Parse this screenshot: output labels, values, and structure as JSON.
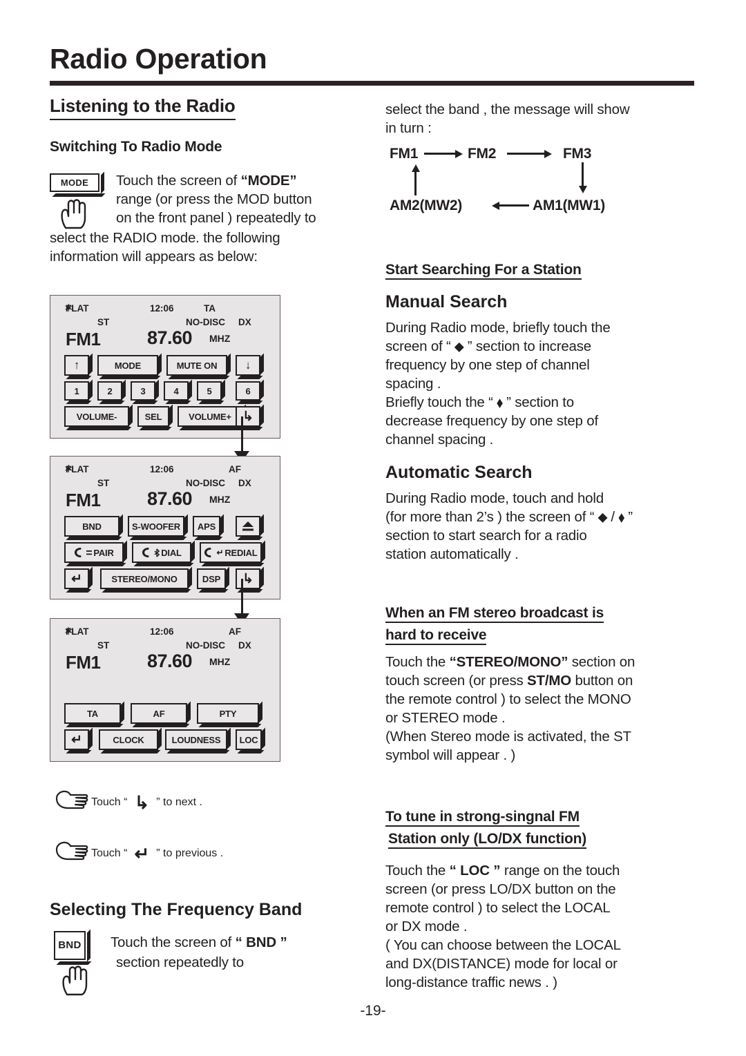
{
  "header": {
    "title": "Radio Operation",
    "page_number": "-19-"
  },
  "left": {
    "section_title": "Listening to the Radio",
    "sub1": "Switching To Radio Mode",
    "mode_key_label": "MODE",
    "mode_para_1": "Touch the screen of ",
    "mode_para_1_b": "“MODE”",
    "mode_para_2": "range (or press the MOD button",
    "mode_para_3": "on the front panel ) repeatedly to",
    "mode_para_4": "select the RADIO mode. the following",
    "mode_para_5": "information will appears as below:",
    "touch_next_pre": "Touch “",
    "touch_next_icon": "next-arrow-icon",
    "touch_next_post": "” to next .",
    "touch_prev_pre": "Touch “",
    "touch_prev_icon": "previous-arrow-icon",
    "touch_prev_post": "” to previous .",
    "sub2": "Selecting The Frequency Band",
    "bnd_key_label": "BND",
    "bnd_para_1": "Touch the screen of ",
    "bnd_para_1_b": "“ BND ”",
    "bnd_para_2": "section repeatedly to"
  },
  "panels": [
    {
      "name": "display-panel-1",
      "status": {
        "bt": "bluetooth-icon",
        "flat": "FLAT",
        "st": "ST",
        "time": "12:06",
        "right_top": "TA",
        "nodisc": "NO-DISC",
        "dx": "DX"
      },
      "band": "FM1",
      "freq": "87.60",
      "unit": "MHZ",
      "buttons": [
        {
          "label": "↑",
          "icon": "up-arrow-icon"
        },
        {
          "label": "MODE",
          "icon": ""
        },
        {
          "label": "MUTE ON",
          "icon": ""
        },
        {
          "label": "↓",
          "icon": "down-arrow-icon"
        },
        {
          "label": "1",
          "icon": ""
        },
        {
          "label": "2",
          "icon": ""
        },
        {
          "label": "3",
          "icon": ""
        },
        {
          "label": "4",
          "icon": ""
        },
        {
          "label": "5",
          "icon": ""
        },
        {
          "label": "6",
          "icon": ""
        },
        {
          "label": "VOLUME-",
          "icon": ""
        },
        {
          "label": "SEL",
          "icon": ""
        },
        {
          "label": "VOLUME+",
          "icon": ""
        },
        {
          "label": "↳",
          "icon": "next-arrow-icon"
        }
      ]
    },
    {
      "name": "display-panel-2",
      "status": {
        "bt": "bluetooth-icon",
        "flat": "FLAT",
        "st": "ST",
        "time": "12:06",
        "right_top": "AF",
        "nodisc": "NO-DISC",
        "dx": "DX"
      },
      "band": "FM1",
      "freq": "87.60",
      "unit": "MHZ",
      "buttons": [
        {
          "label": "BND",
          "icon": ""
        },
        {
          "label": "S-WOOFER",
          "icon": ""
        },
        {
          "label": "APS",
          "icon": ""
        },
        {
          "label": "⏏",
          "icon": "eject-icon"
        },
        {
          "label": "PAIR",
          "icon": "phone-pair-icon"
        },
        {
          "label": "DIAL",
          "icon": "phone-dial-icon"
        },
        {
          "label": "REDIAL",
          "icon": "phone-redial-icon"
        },
        {
          "label": "↵",
          "icon": "previous-arrow-icon"
        },
        {
          "label": "STEREO/MONO",
          "icon": ""
        },
        {
          "label": "DSP",
          "icon": ""
        },
        {
          "label": "↳",
          "icon": "next-arrow-icon"
        }
      ]
    },
    {
      "name": "display-panel-3",
      "status": {
        "bt": "bluetooth-icon",
        "flat": "FLAT",
        "st": "ST",
        "time": "12:06",
        "right_top": "AF",
        "nodisc": "NO-DISC",
        "dx": "DX"
      },
      "band": "FM1",
      "freq": "87.60",
      "unit": "MHZ",
      "buttons": [
        {
          "label": "TA",
          "icon": ""
        },
        {
          "label": "AF",
          "icon": ""
        },
        {
          "label": "PTY",
          "icon": ""
        },
        {
          "label": "↵",
          "icon": "previous-arrow-icon"
        },
        {
          "label": "CLOCK",
          "icon": ""
        },
        {
          "label": "LOUDNESS",
          "icon": ""
        },
        {
          "label": "LOC",
          "icon": ""
        }
      ]
    }
  ],
  "right": {
    "intro_1": "select the band , the message will show",
    "intro_2": "in turn :",
    "flow": {
      "fm1": "FM1",
      "fm2": "FM2",
      "fm3": "FM3",
      "am1": "AM1(MW1)",
      "am2": "AM2(MW2)"
    },
    "h_start_search": "Start Searching For a Station",
    "h_manual": "Manual Search",
    "manual_1": "During Radio mode, briefly touch the",
    "manual_2a": "screen of  “ ",
    "manual_2b": " ” section to increase",
    "manual_3": "frequency by one step of channel",
    "manual_4": "spacing .",
    "manual_5a": "Briefly touch the “ ",
    "manual_5b": " ” section to",
    "manual_6": "decrease frequency by one step of",
    "manual_7": "channel spacing .",
    "h_auto": "Automatic Search",
    "auto_1": "During Radio mode, touch and hold",
    "auto_2a": "(for more than 2’s ) the screen of “ ",
    "auto_2b": " ”",
    "auto_3": "section to start search for a radio",
    "auto_4": "station automatically .",
    "h_stereo_1": "When an FM stereo broadcast is",
    "h_stereo_2": "hard to receive",
    "stereo_1a": "Touch the ",
    "stereo_1b": "“STEREO/MONO”",
    "stereo_1c": " section on",
    "stereo_2a": "touch screen (or press ",
    "stereo_2b": "ST/MO",
    "stereo_2c": " button on",
    "stereo_3": "the remote control ) to select the MONO",
    "stereo_4": "or STEREO mode .",
    "stereo_5": "(When Stereo mode is activated, the ST",
    "stereo_6": "symbol will appear . )",
    "h_lodx_1": "To tune in strong-singnal FM",
    "h_lodx_2": "Station only (LO/DX function)",
    "lodx_1a": "Touch the ",
    "lodx_1b": "“ LOC ”",
    "lodx_1c": " range on the touch",
    "lodx_2": "screen (or press LO/DX button on the",
    "lodx_3": "remote control ) to select the LOCAL",
    "lodx_4": "or DX mode .",
    "lodx_5": "( You can choose between the LOCAL",
    "lodx_6": "and DX(DISTANCE)  mode for local or",
    "lodx_7": "long-distance traffic news . )"
  }
}
